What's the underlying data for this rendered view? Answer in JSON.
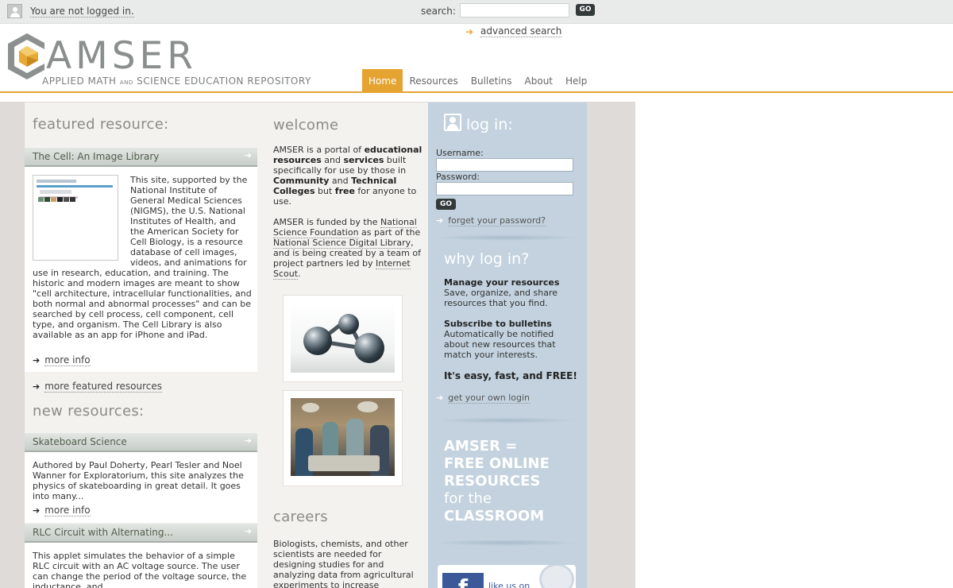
{
  "topbar": {
    "login_status": "You are not logged in.",
    "search_label": "search:",
    "search_value": "",
    "search_go": "GO",
    "advanced_search": "advanced search"
  },
  "logo": {
    "name": "AMSER",
    "subtitle_part1": "APPLIED MATH",
    "subtitle_and": "AND",
    "subtitle_part2": "SCIENCE EDUCATION REPOSITORY"
  },
  "nav": {
    "items": [
      "Home",
      "Resources",
      "Bulletins",
      "About",
      "Help"
    ],
    "active": "Home"
  },
  "featured": {
    "heading": "featured resource:",
    "title": "The Cell: An Image Library",
    "description": "This site, supported by the National Institute of General Medical Sciences (NIGMS), the U.S. National Institutes of Health, and the American Society for Cell Biology, is a resource database of cell images, videos, and animations for use in research, education, and training. The historic and modern images are meant to show \"cell architecture, intracellular functionalities, and both normal and abnormal processes\" and can be searched by cell process, cell component, cell type, and organism. The Cell Library is also available as an app for iPhone and iPad.",
    "more_info": "more info",
    "more_featured": "more featured resources"
  },
  "new_resources": {
    "heading": "new resources:",
    "items": [
      {
        "title": "Skateboard Science",
        "description": "Authored by Paul Doherty, Pearl Tesler and Noel Wanner for Exploratorium, this site analyzes the physics of skateboarding in great detail. It goes into many...",
        "more_info": "more info"
      },
      {
        "title": "RLC Circuit with Alternating...",
        "description": "This applet simulates the behavior of a simple RLC circuit with an AC voltage source. The user can change the period of the voltage source, the inductance, and...",
        "more_info": "more info"
      }
    ]
  },
  "welcome": {
    "heading": "welcome",
    "p1": {
      "t1": "AMSER is a portal of ",
      "b1": "educational resources",
      "t2": " and ",
      "b2": "services",
      "t3": " built specifically for use by those in ",
      "b3": "Community",
      "t4": " and ",
      "b4": "Technical Colleges",
      "t5": " but ",
      "b5": "free",
      "t6": " for anyone to use."
    },
    "p2": {
      "t1": "AMSER is funded by the ",
      "l1": "National Science Foundation",
      "t2": " as part of the ",
      "l2": "National Science Digital Library",
      "t3": ", and is being created by a team of project partners led by ",
      "l3": "Internet Scout",
      "t4": "."
    }
  },
  "careers": {
    "heading": "careers",
    "text": "Biologists, chemists, and other scientists are needed for designing studies for and analyzing data from agricultural experiments to increase"
  },
  "login": {
    "heading": "log in:",
    "username_label": "Username:",
    "password_label": "Password:",
    "username_value": "",
    "password_value": "",
    "go": "GO",
    "forgot": "forget your password?"
  },
  "why": {
    "heading": "why log in?",
    "manage_title": "Manage your resources",
    "manage_text": "Save, organize, and share resources that you find.",
    "subscribe_title": "Subscribe to bulletins",
    "subscribe_text": "Automatically be notified about new resources that match your interests.",
    "free_line": "It's easy, fast, and FREE!",
    "get_login": "get your own login"
  },
  "promo": {
    "line1": "AMSER =",
    "line2": "FREE ONLINE",
    "line3": "RESOURCES",
    "line4": "for the",
    "line5": "CLASSROOM"
  },
  "facebook": {
    "logo": "f",
    "text": "like us on"
  },
  "colors": {
    "accent": "#e5a431",
    "login_panel": "#c3d2de",
    "facebook": "#3b5998"
  }
}
